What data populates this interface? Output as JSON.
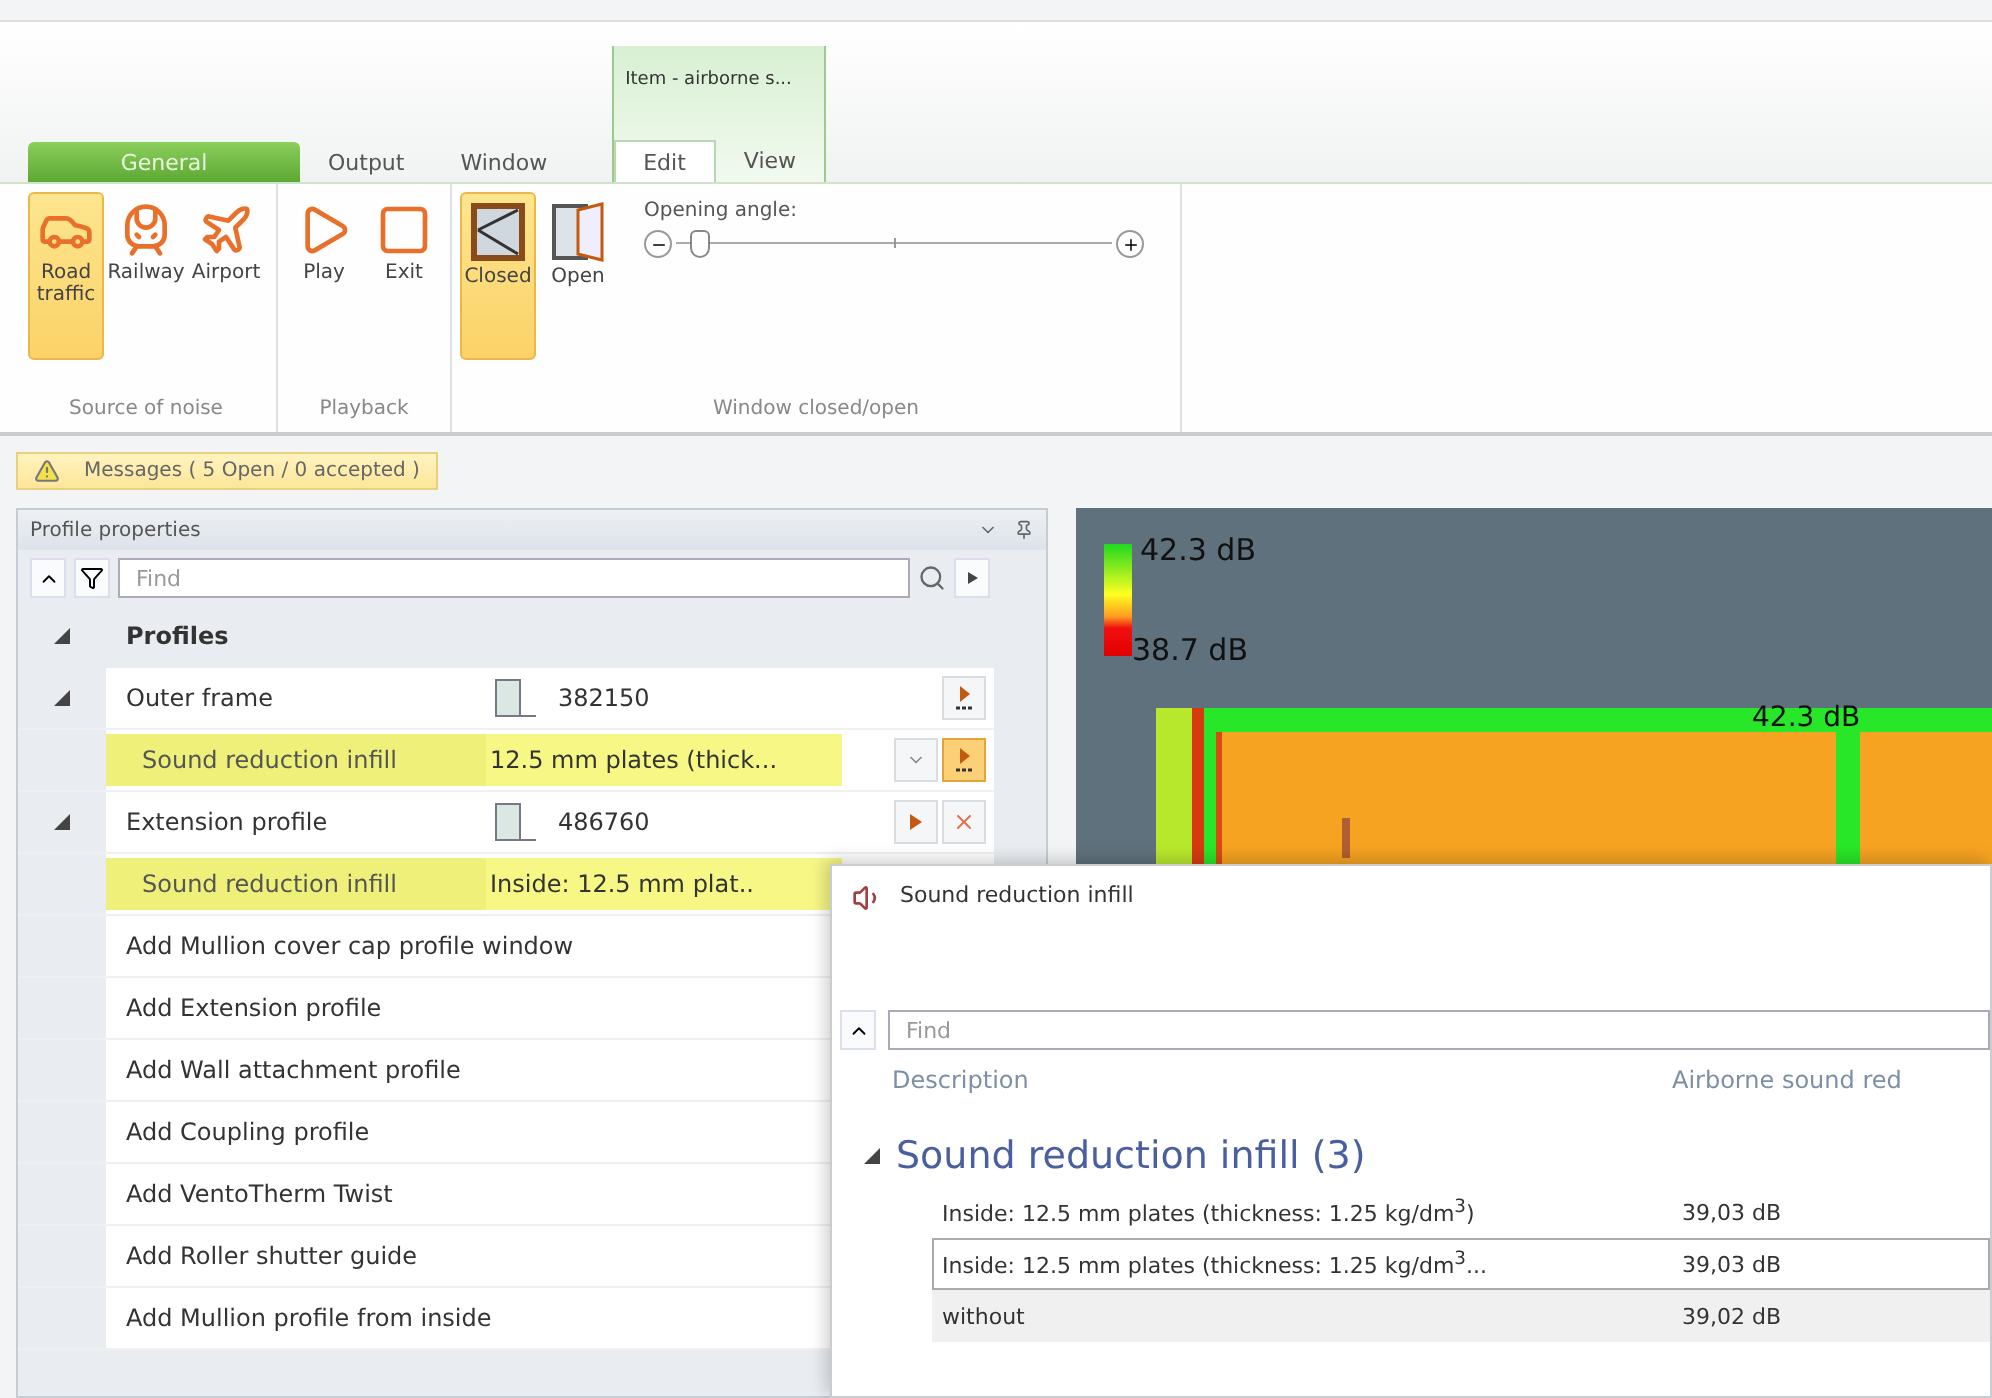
{
  "ribbon": {
    "context_tab": "Item - airborne s...",
    "tabs": [
      {
        "label": "General",
        "kind": "app",
        "selected": false
      },
      {
        "label": "Output",
        "kind": "tab",
        "selected": false
      },
      {
        "label": "Window",
        "kind": "tab",
        "selected": false
      },
      {
        "label": "Edit",
        "kind": "context",
        "selected": true
      },
      {
        "label": "View",
        "kind": "context",
        "selected": false
      }
    ],
    "groups": [
      {
        "title": "Source of noise",
        "buttons": [
          {
            "label": "Road traffic",
            "selected": true
          },
          {
            "label": "Railway",
            "selected": false
          },
          {
            "label": "Airport",
            "selected": false
          }
        ]
      },
      {
        "title": "Playback",
        "buttons": [
          {
            "label": "Play",
            "selected": false
          },
          {
            "label": "Exit",
            "selected": false
          }
        ]
      },
      {
        "title": "Window closed/open",
        "buttons": [
          {
            "label": "Closed",
            "selected": true
          },
          {
            "label": "Open",
            "selected": false
          }
        ],
        "slider": {
          "label": "Opening angle:",
          "level": 0.03
        }
      }
    ]
  },
  "messages": "Messages ( 5 Open / 0 accepted )",
  "panel": {
    "title": "Profile properties",
    "search": {
      "placeholder": "Find"
    },
    "tree": [
      {
        "label": "Profiles",
        "kind": "category",
        "expanded": true,
        "children": [
          {
            "label": "Outer frame",
            "kind": "profile",
            "value": "382150",
            "expanded": true,
            "buttons": [
              {
                "kind": "more",
                "active": false
              }
            ],
            "children": [
              {
                "label": "Sound reduction infill",
                "kind": "infill",
                "value": "12.5 mm plates (thick...",
                "highlighted": true,
                "buttons": [
                  {
                    "kind": "dropdown",
                    "active": false
                  },
                  {
                    "kind": "more",
                    "active": true
                  }
                ]
              }
            ]
          },
          {
            "label": "Extension profile",
            "kind": "profile",
            "value": "486760",
            "expanded": true,
            "buttons": [
              {
                "kind": "play",
                "active": false
              },
              {
                "kind": "delete",
                "active": false
              }
            ],
            "children": [
              {
                "label": "Sound reduction infill",
                "kind": "infill",
                "value": "Inside: 12.5 mm plat..",
                "highlighted": true
              }
            ]
          },
          {
            "label": "Add Mullion cover cap profile window",
            "kind": "action"
          },
          {
            "label": "Add Extension profile",
            "kind": "action"
          },
          {
            "label": "Add Wall attachment profile",
            "kind": "action"
          },
          {
            "label": "Add Coupling profile",
            "kind": "action"
          },
          {
            "label": "Add VentoTherm Twist",
            "kind": "action"
          },
          {
            "label": "Add Roller shutter guide",
            "kind": "action"
          },
          {
            "label": "Add Mullion profile from inside",
            "kind": "action"
          }
        ]
      }
    ]
  },
  "view": {
    "scale": [
      "42.3 dB",
      "38.7 dB"
    ],
    "frame_label": "42.3 dB"
  },
  "popup": {
    "title": "Sound reduction infill",
    "search": {
      "placeholder": "Find"
    },
    "columns": [
      "Description",
      "Airborne sound red"
    ],
    "group": {
      "label": "Sound reduction infill (3)",
      "expanded": true
    },
    "rows": [
      {
        "description": "Inside: 12.5 mm plates (thickness: 1.25 kg/dm$^{3}$)",
        "value": "39,03 dB",
        "selected": false
      },
      {
        "description": "Inside: 12.5 mm plates (thickness: 1.25 kg/dm$^{3}$...",
        "value": "39,03 dB",
        "selected": true
      },
      {
        "description": "without",
        "value": "39,02 dB",
        "selected": false
      }
    ]
  }
}
